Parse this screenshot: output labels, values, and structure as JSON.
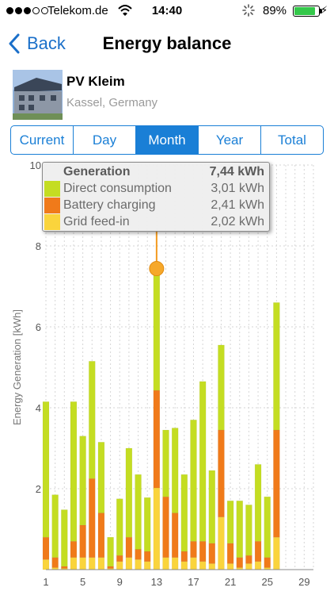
{
  "status_bar": {
    "carrier": "Telekom.de",
    "time": "14:40",
    "battery": "89%",
    "battery_level": 0.89
  },
  "nav": {
    "back_label": "Back",
    "title": "Energy balance"
  },
  "plant": {
    "name": "PV Kleim",
    "location": "Kassel, Germany"
  },
  "tabs": [
    "Current",
    "Day",
    "Month",
    "Year",
    "Total"
  ],
  "active_tab": "Month",
  "tooltip": {
    "header_label": "Generation",
    "header_value": "7,44 kWh",
    "rows": [
      {
        "label": "Direct consumption",
        "value": "3,01 kWh",
        "color": "#c4dd22"
      },
      {
        "label": "Battery charging",
        "value": "2,41 kWh",
        "color": "#f07a1a"
      },
      {
        "label": "Grid feed-in",
        "value": "2,02 kWh",
        "color": "#fad43c"
      }
    ]
  },
  "chart_data": {
    "type": "bar",
    "stacked": true,
    "ylabel": "Energy Generation [kWh]",
    "ylim": [
      0,
      10
    ],
    "yticks": [
      2,
      4,
      6,
      8,
      10
    ],
    "xticks": [
      1,
      5,
      9,
      13,
      17,
      21,
      25,
      29
    ],
    "xlim": [
      1,
      30
    ],
    "highlight_day": 13,
    "colors": {
      "direct": "#c4dd22",
      "battery": "#f07a1a",
      "grid": "#fad43c"
    },
    "series": [
      {
        "name": "Grid feed-in",
        "key": "grid",
        "values": [
          0.25,
          0.05,
          0.03,
          0.3,
          0.3,
          0.3,
          0.3,
          0.03,
          0.2,
          0.3,
          0.25,
          0.2,
          2.02,
          0.3,
          0.3,
          0.2,
          0.3,
          0.2,
          0.15,
          1.3,
          0.15,
          0.05,
          0.15,
          0.2,
          0.05,
          0.8
        ]
      },
      {
        "name": "Battery charging",
        "key": "battery",
        "values": [
          0.55,
          0.25,
          0.05,
          0.4,
          0.8,
          1.95,
          1.1,
          0.05,
          0.15,
          0.5,
          0.25,
          0.25,
          2.41,
          1.5,
          1.1,
          0.25,
          0.4,
          0.5,
          0.5,
          2.15,
          0.5,
          0.25,
          0.2,
          0.5,
          0.25,
          2.65
        ]
      },
      {
        "name": "Direct consumption",
        "key": "direct",
        "values": [
          3.35,
          1.55,
          1.4,
          3.45,
          2.2,
          2.9,
          1.75,
          0.72,
          1.4,
          2.2,
          1.85,
          1.33,
          3.01,
          1.65,
          2.1,
          1.9,
          3.0,
          3.95,
          1.8,
          2.1,
          1.05,
          1.4,
          1.25,
          1.9,
          1.5,
          3.15
        ]
      }
    ],
    "days": [
      1,
      2,
      3,
      4,
      5,
      6,
      7,
      8,
      9,
      10,
      11,
      12,
      13,
      14,
      15,
      16,
      17,
      18,
      19,
      20,
      21,
      22,
      23,
      24,
      25,
      26
    ]
  }
}
